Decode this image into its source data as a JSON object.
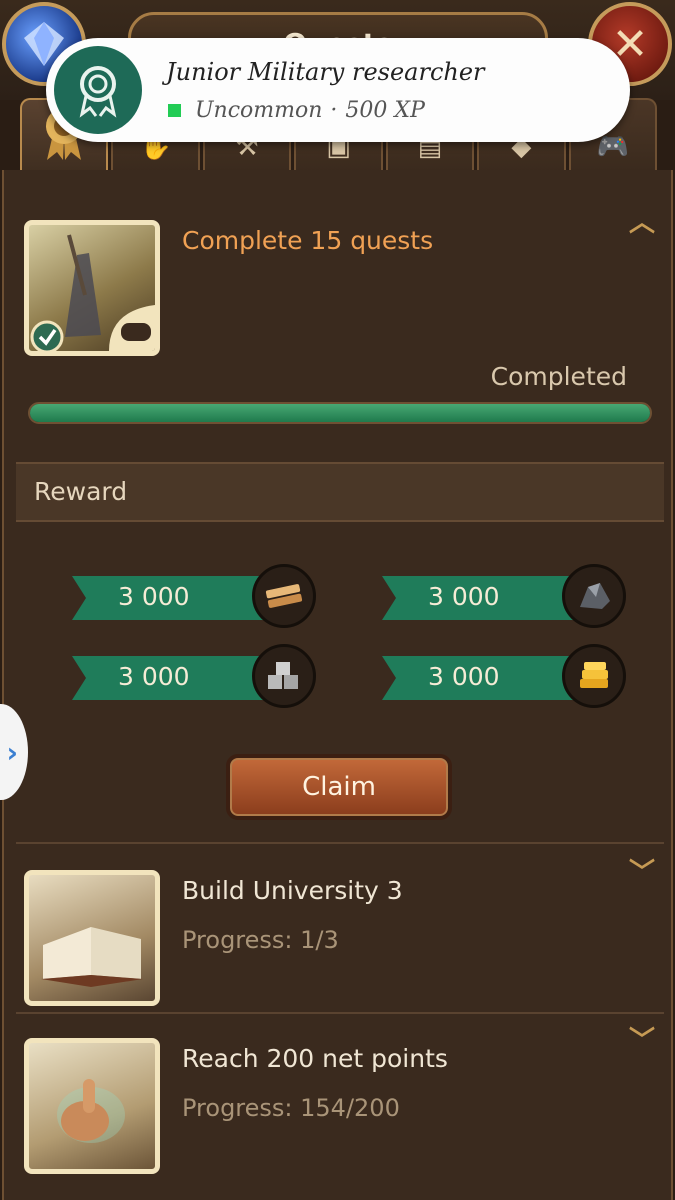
{
  "header": {
    "title": "Quests"
  },
  "tabs": [
    {
      "icon": "award-ribbon-icon"
    },
    {
      "icon": "handshake-icon"
    },
    {
      "icon": "hammer-icon"
    },
    {
      "icon": "vehicle-icon"
    },
    {
      "icon": "building-icon"
    },
    {
      "icon": "diamond-icon"
    },
    {
      "icon": "gamepad-icon"
    }
  ],
  "toast": {
    "title": "Junior Military researcher",
    "rarity": "Uncommon",
    "separator": "·",
    "xp": "500 XP",
    "rarity_color": "#22cc55"
  },
  "active_quest": {
    "title": "Complete 15 quests",
    "status": "Completed",
    "progress_fraction": 1.0,
    "title_color": "#f0a154"
  },
  "reward": {
    "header": "Reward",
    "items": [
      {
        "amount": "3 000",
        "resource": "wood-planks-icon"
      },
      {
        "amount": "3 000",
        "resource": "coal-ore-icon"
      },
      {
        "amount": "3 000",
        "resource": "stone-blocks-icon"
      },
      {
        "amount": "3 000",
        "resource": "gold-bars-icon"
      }
    ],
    "claim_label": "Claim"
  },
  "quests": [
    {
      "title": "Build University 3",
      "progress": "Progress: 1/3"
    },
    {
      "title": "Reach 200 net points",
      "progress": "Progress: 154/200"
    }
  ]
}
